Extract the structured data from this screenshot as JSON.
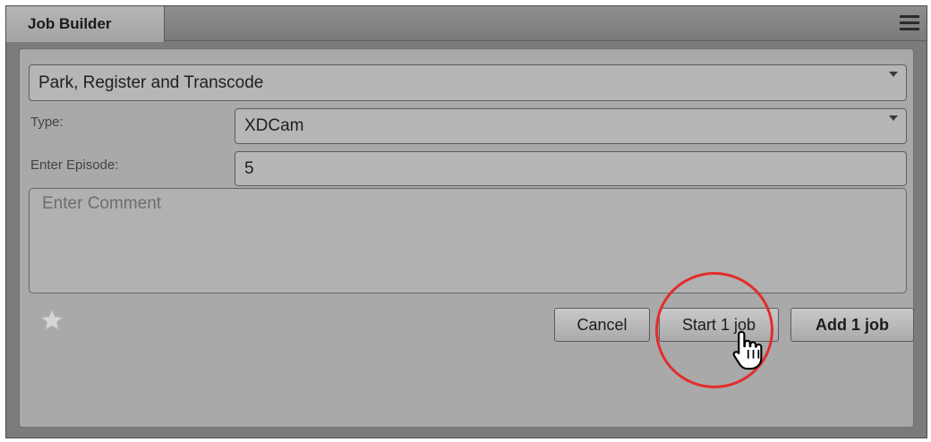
{
  "window": {
    "tab_title": "Job Builder"
  },
  "form": {
    "workflow_value": "Park, Register and Transcode",
    "type_label": "Type:",
    "type_value": "XDCam",
    "episode_label": "Enter Episode:",
    "episode_value": "5",
    "comment_placeholder": "Enter Comment"
  },
  "buttons": {
    "cancel": "Cancel",
    "start": "Start 1 job",
    "add": "Add 1 job"
  },
  "icons": {
    "favorite": "star-icon",
    "menu": "hamburger-menu-icon",
    "cursor": "hand-pointer-icon"
  },
  "colors": {
    "highlight_circle": "#e22d2d"
  }
}
